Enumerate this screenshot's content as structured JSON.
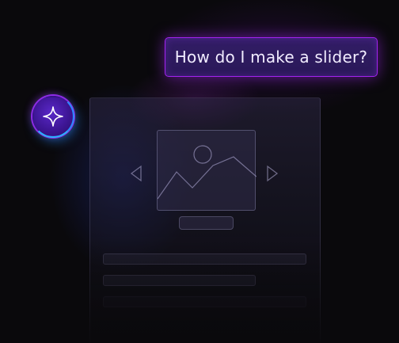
{
  "prompt": {
    "text": "How do I make a slider?"
  },
  "ai_button": {
    "icon": "sparkle-icon"
  },
  "slider_mockup": {
    "image_icon": "image-placeholder-icon",
    "prev_icon": "chevron-left-icon",
    "next_icon": "chevron-right-icon"
  },
  "colors": {
    "background": "#0a090c",
    "accent_purple": "#a322f0",
    "accent_blue": "#29b4ff",
    "bubble_fill": "#2f1b62"
  }
}
